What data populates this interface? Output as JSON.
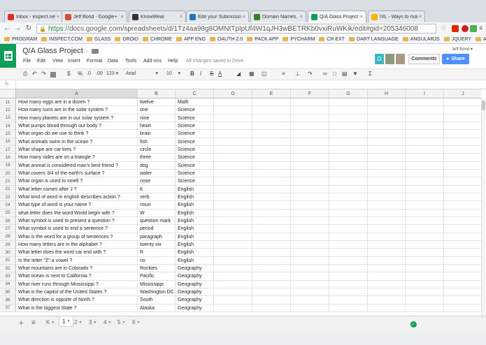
{
  "browser": {
    "tabs": [
      {
        "title": "Inbox - inspect.net",
        "color": "#d93025",
        "active": false
      },
      {
        "title": "Jeff Bond - Google+",
        "color": "#dd4b39",
        "active": false
      },
      {
        "title": "KnowWear",
        "color": "#333333",
        "active": false
      },
      {
        "title": "Edit your Submission",
        "color": "#1e73be",
        "active": false
      },
      {
        "title": "Domain Names, Web",
        "color": "#3b7a2a",
        "active": false
      },
      {
        "title": "Q/A Glass Project",
        "color": "#0f9d58",
        "active": true
      },
      {
        "title": "IXL - Ways to make",
        "color": "#f5b400",
        "active": false
      }
    ],
    "url_https": "https://",
    "url_rest": "docs.google.com/spreadsheets/d/1Tz4aa98g8OMNtTpIpUf4W1qJH3wBETRKb0vxiRuWKik/edit#gid=205346008",
    "bookmarks": [
      "PROGRAM",
      "INSPECT.COM",
      "GLASS",
      "DROID",
      "CHROME",
      "APP ENG",
      "OAUTH 2.0",
      "PACK APP",
      "PYCHARM",
      "CR EXT",
      "DART LANGUAGE",
      "ANGULARJS",
      "JQUERY",
      "AI"
    ]
  },
  "doc": {
    "title": "Q/A Glass Project",
    "menus": [
      "File",
      "Edit",
      "View",
      "Insert",
      "Format",
      "Data",
      "Tools",
      "Add-ons",
      "Help"
    ],
    "save_status": "All changes saved in Drive",
    "user": "Jeff Bond",
    "comments_label": "Comments",
    "share_label": "Share",
    "avatar_letter": "D"
  },
  "toolbar": {
    "font": "Arial",
    "size": "10",
    "currency": "$",
    "percent": "%",
    "decimal_less": ".0",
    "decimal_more": ".00",
    "format_more": "123",
    "bold": "B",
    "italic": "I",
    "strike": "S",
    "text_color": "A",
    "function": "Σ"
  },
  "formula_bar": {
    "label": "fx",
    "value": ""
  },
  "sheet": {
    "columns": [
      "A",
      "B",
      "C",
      "D",
      "E",
      "F",
      "G",
      "H",
      "I",
      "J"
    ],
    "rows": [
      {
        "n": "11",
        "a": "How many eggs are in a dozen ?",
        "b": "twelve",
        "c": "Math"
      },
      {
        "n": "12",
        "a": "How many suns are in the solar system ?",
        "b": "one",
        "c": "Science"
      },
      {
        "n": "13",
        "a": "How many planets are in our solar system ?",
        "b": "nine",
        "c": "Science"
      },
      {
        "n": "14",
        "a": "What pumps blood through our body ?",
        "b": "heart",
        "c": "Science"
      },
      {
        "n": "15",
        "a": "What organ do we use to think ?",
        "b": "brain",
        "c": "Science"
      },
      {
        "n": "16",
        "a": "What animals swim in the ocean ?",
        "b": "fish",
        "c": "Science"
      },
      {
        "n": "17",
        "a": "What shape are car tires ?",
        "b": "circle",
        "c": "Science"
      },
      {
        "n": "18",
        "a": "How many sides are on a triangle ?",
        "b": "three",
        "c": "Science"
      },
      {
        "n": "19",
        "a": "What animal is considered man's best friend ?",
        "b": "dog",
        "c": "Science"
      },
      {
        "n": "20",
        "a": "What covers 3/4 of the earth's surface ?",
        "b": "water",
        "c": "Science"
      },
      {
        "n": "21",
        "a": "What organ is used to smell ?",
        "b": "nose",
        "c": "Science"
      },
      {
        "n": "22",
        "a": "What letter comes after J ?",
        "b": "K",
        "c": "English"
      },
      {
        "n": "23",
        "a": "What kind of word in english describes action ?",
        "b": "verb",
        "c": "English"
      },
      {
        "n": "24",
        "a": "What type of word is your name ?",
        "b": "noun",
        "c": "English"
      },
      {
        "n": "25",
        "a": "what letter does the word World begin with ?",
        "b": "W",
        "c": "English"
      },
      {
        "n": "26",
        "a": "What symbol is used to present a question ?",
        "b": "question mark",
        "c": "English"
      },
      {
        "n": "27",
        "a": "What symbol is used to end a sentence ?",
        "b": "period",
        "c": "English"
      },
      {
        "n": "28",
        "a": "What is the word for a group of sentences ?",
        "b": "paragraph",
        "c": "English"
      },
      {
        "n": "29",
        "a": "How many letters are in the alphabet ?",
        "b": "twenty six",
        "c": "English"
      },
      {
        "n": "30",
        "a": "What letter does the word car end with ?",
        "b": "R",
        "c": "English"
      },
      {
        "n": "31",
        "a": "Is the letter \"Z\" a vowel ?",
        "b": "no",
        "c": "English"
      },
      {
        "n": "32",
        "a": "What mountains are in Colorado ?",
        "b": "Rockies",
        "c": "Geography"
      },
      {
        "n": "33",
        "a": "What ocean is next to California ?",
        "b": "Pacific",
        "c": "Geography"
      },
      {
        "n": "34",
        "a": "What river runs through Mississippi ?",
        "b": "Mississippi",
        "c": "Geography"
      },
      {
        "n": "35",
        "a": "What is the capitol of the United States ?",
        "b": "Washington DC",
        "c": "Geography"
      },
      {
        "n": "36",
        "a": "What direction is oppsite of North ?",
        "b": "South",
        "c": "Geography"
      },
      {
        "n": "37",
        "a": "What is the biggest State ?",
        "b": "Alaska",
        "c": "Geography"
      }
    ]
  },
  "sheet_tabs": {
    "add": "+",
    "list": "≡",
    "prefix": "K",
    "tabs": [
      "1",
      "2",
      "3",
      "4",
      "5",
      "6"
    ],
    "active": "1"
  }
}
